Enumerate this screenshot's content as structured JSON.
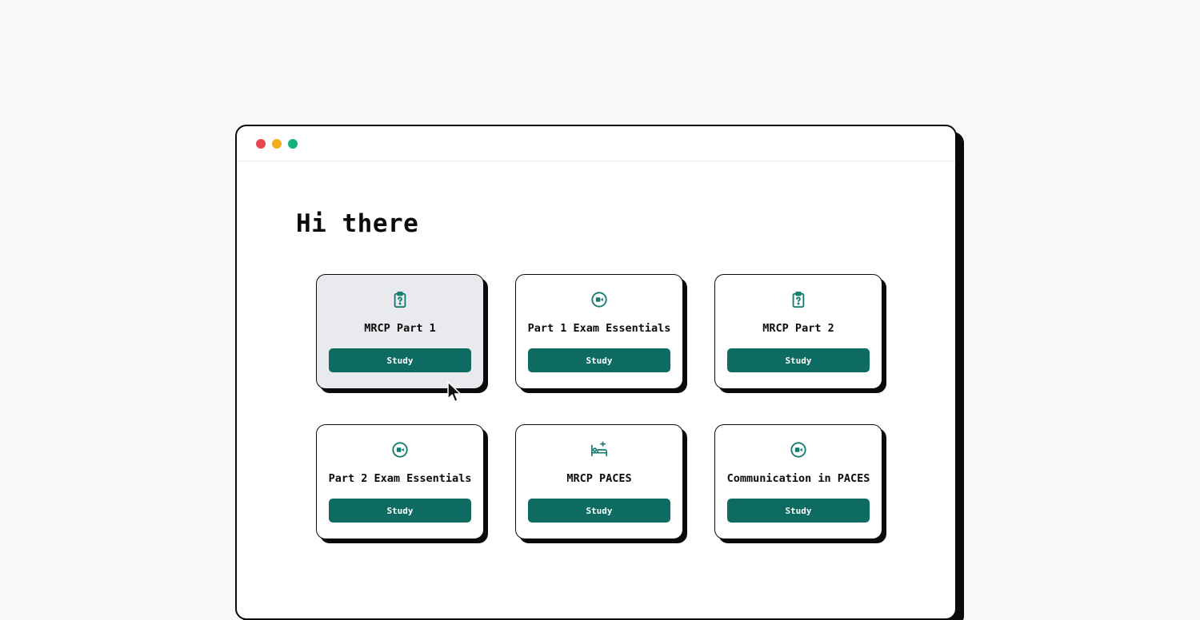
{
  "window": {
    "controls": [
      "close",
      "minimize",
      "maximize"
    ]
  },
  "greeting": "Hi there",
  "cards": [
    {
      "title": "MRCP Part 1",
      "icon": "clipboard-question-icon",
      "button": "Study",
      "hovered": true
    },
    {
      "title": "Part 1 Exam Essentials",
      "icon": "video-icon",
      "button": "Study"
    },
    {
      "title": "MRCP Part 2",
      "icon": "clipboard-question-icon",
      "button": "Study"
    },
    {
      "title": "Part 2 Exam Essentials",
      "icon": "video-icon",
      "button": "Study"
    },
    {
      "title": "MRCP PACES",
      "icon": "hospital-bed-icon",
      "button": "Study"
    },
    {
      "title": "Communication in PACES",
      "icon": "video-icon",
      "button": "Study"
    }
  ],
  "colors": {
    "accent": "#0d6b61",
    "icon": "#137a6f",
    "hover_card": "#e9eaed",
    "close_dot": "#e5484d",
    "minimize_dot": "#f0ad1f",
    "maximize_dot": "#15b07f"
  }
}
